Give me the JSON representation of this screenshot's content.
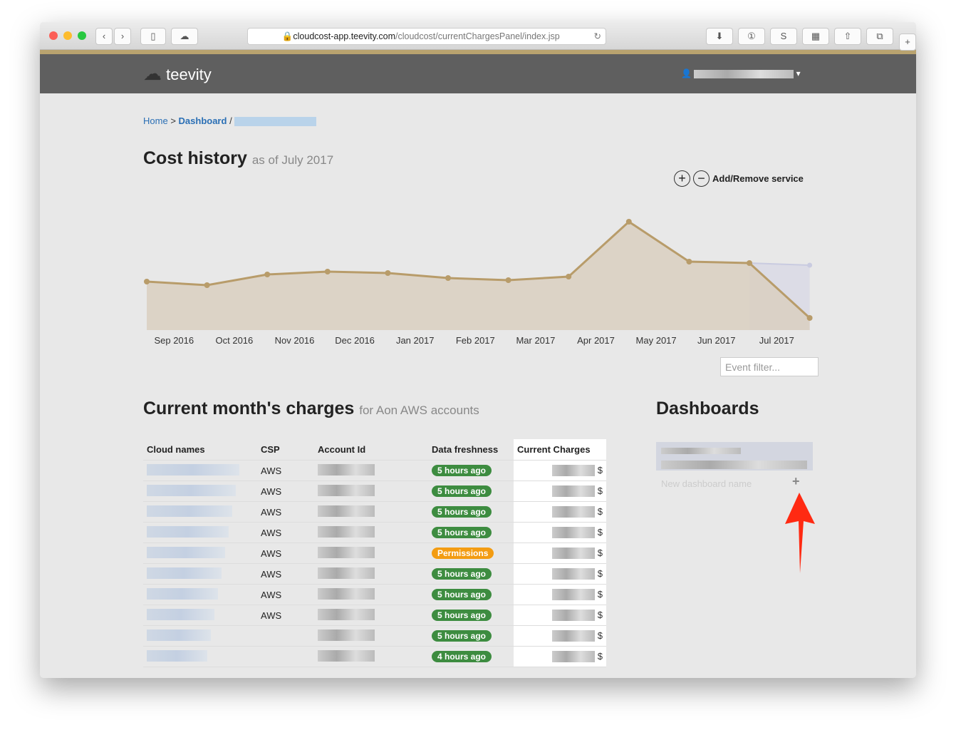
{
  "browser": {
    "url_domain": "cloudcost-app.teevity.com",
    "url_path": "/cloudcost/currentChargesPanel/index.jsp"
  },
  "header": {
    "logo_text": "teevity",
    "user_icon": "user-icon"
  },
  "breadcrumb": {
    "home": "Home",
    "sep1": ">",
    "dashboard": "Dashboard",
    "sep2": "/"
  },
  "cost_history": {
    "title": "Cost history",
    "subtitle": "as of July 2017",
    "add_remove": "Add/Remove service",
    "event_filter_placeholder": "Event filter..."
  },
  "chart_data": {
    "type": "area",
    "title": "Cost history",
    "categories": [
      "Sep 2016",
      "Oct 2016",
      "Nov 2016",
      "Dec 2016",
      "Jan 2017",
      "Feb 2017",
      "Mar 2017",
      "Apr 2017",
      "May 2017",
      "Jun 2017",
      "Jul 2017"
    ],
    "values": [
      68,
      63,
      78,
      82,
      80,
      73,
      70,
      75,
      152,
      96,
      94,
      17
    ],
    "forecast_end": 91,
    "colors": {
      "line": "#b89c6a",
      "fill": "#d9cfbf",
      "forecast": "#dcdce6"
    },
    "yaxis_shown": false
  },
  "charges": {
    "title": "Current month's charges",
    "subtitle": "for Aon AWS accounts",
    "columns": [
      "Cloud names",
      "CSP",
      "Account Id",
      "Data freshness",
      "Current Charges"
    ],
    "rows": [
      {
        "csp": "AWS",
        "fresh": "5 hours ago"
      },
      {
        "csp": "AWS",
        "fresh": "5 hours ago"
      },
      {
        "csp": "AWS",
        "fresh": "5 hours ago"
      },
      {
        "csp": "AWS",
        "fresh": "5 hours ago"
      },
      {
        "csp": "AWS",
        "fresh": "Permissions",
        "warn": true
      },
      {
        "csp": "AWS",
        "fresh": "5 hours ago"
      },
      {
        "csp": "AWS",
        "fresh": "5 hours ago"
      },
      {
        "csp": "AWS",
        "fresh": "5 hours ago"
      },
      {
        "csp": "",
        "fresh": "5 hours ago"
      },
      {
        "csp": "",
        "fresh": "4 hours ago"
      }
    ],
    "currency": "$"
  },
  "dashboards": {
    "title": "Dashboards",
    "new_placeholder": "New dashboard name",
    "add": "+"
  }
}
